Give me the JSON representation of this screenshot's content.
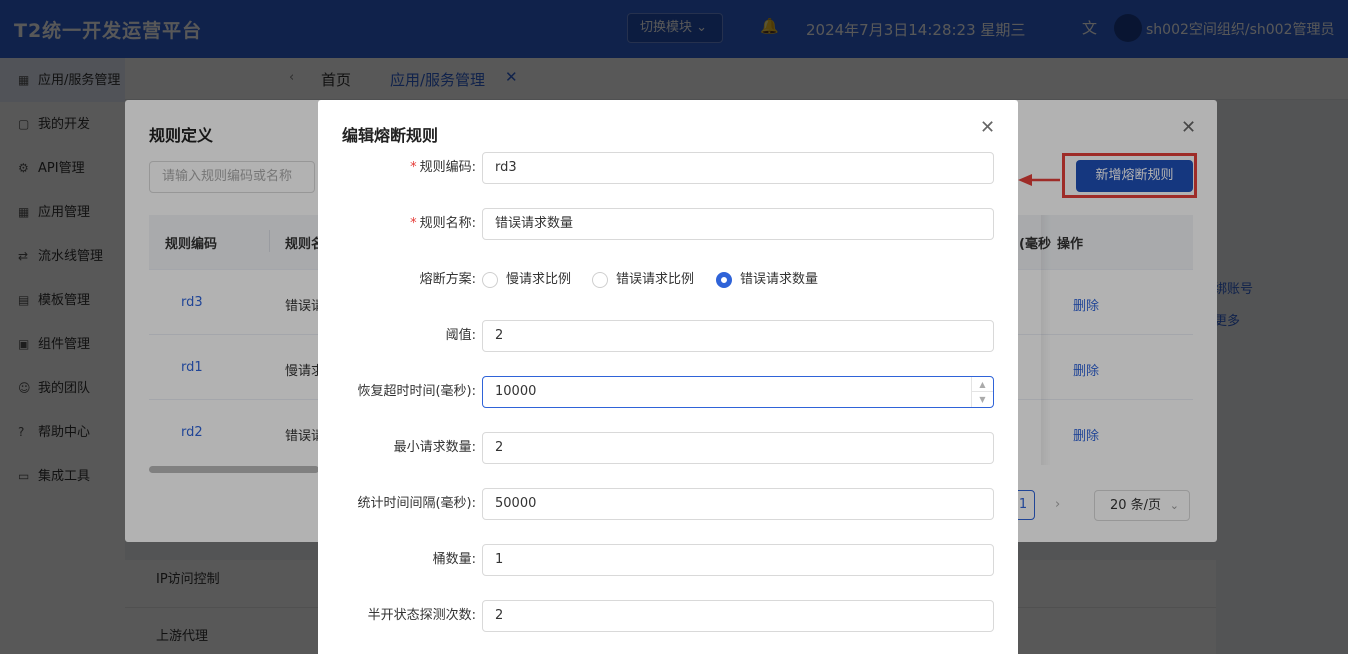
{
  "app": {
    "title": "T2统一开发运营平台",
    "switch_label": "切换模块",
    "datetime": "2024年7月3日14:28:23 星期三",
    "user": "sh002空间组织/sh002管理员"
  },
  "sidebar": {
    "items": [
      {
        "icon": "▦",
        "label": "应用/服务管理"
      },
      {
        "icon": "▢",
        "label": "我的开发"
      },
      {
        "icon": "⚙",
        "label": "API管理"
      },
      {
        "icon": "▦",
        "label": "应用管理"
      },
      {
        "icon": "⇄",
        "label": "流水线管理"
      },
      {
        "icon": "▤",
        "label": "模板管理"
      },
      {
        "icon": "▣",
        "label": "组件管理"
      },
      {
        "icon": "☺",
        "label": "我的团队"
      },
      {
        "icon": "?",
        "label": "帮助中心"
      },
      {
        "icon": "▭",
        "label": "集成工具"
      }
    ]
  },
  "tabs": [
    {
      "label": "首页"
    },
    {
      "label": "应用/服务管理"
    }
  ],
  "background_list": {
    "items": [
      "IP访问控制",
      "上游代理"
    ],
    "right_links": [
      "绑账号",
      "更多"
    ]
  },
  "rule_dialog": {
    "title": "规则定义",
    "search_placeholder": "请输入规则编码或名称",
    "add_button": "新增熔断规则",
    "columns": {
      "code": "规则编码",
      "name": "规则名",
      "partial": "(毫秒",
      "ops": "操作"
    },
    "rows": [
      {
        "code": "rd3",
        "name": "错误请",
        "action": "删除"
      },
      {
        "code": "rd1",
        "name": "慢请求",
        "action": "删除"
      },
      {
        "code": "rd2",
        "name": "错误请",
        "action": "删除"
      }
    ],
    "pagination": {
      "current": "1",
      "page_size": "20 条/页"
    }
  },
  "edit_dialog": {
    "title": "编辑熔断规则",
    "fields": {
      "code": {
        "label": "规则编码:",
        "value": "rd3",
        "required": true
      },
      "name": {
        "label": "规则名称:",
        "value": "错误请求数量",
        "required": true
      },
      "strategy": {
        "label": "熔断方案:",
        "options": [
          "慢请求比例",
          "错误请求比例",
          "错误请求数量"
        ],
        "selected": "错误请求数量"
      },
      "threshold": {
        "label": "阈值:",
        "value": "2"
      },
      "recovery_timeout": {
        "label": "恢复超时时间(毫秒):",
        "value": "10000"
      },
      "min_requests": {
        "label": "最小请求数量:",
        "value": "2"
      },
      "stat_interval": {
        "label": "统计时间间隔(毫秒):",
        "value": "50000"
      },
      "bucket_count": {
        "label": "桶数量:",
        "value": "1"
      },
      "half_open_probes": {
        "label": "半开状态探测次数:",
        "value": "2"
      }
    }
  },
  "colors": {
    "primary": "#2f63d8",
    "button_dark": "#1f4fb7",
    "annotation_red": "#e3403a",
    "required_star": "#e53935"
  }
}
